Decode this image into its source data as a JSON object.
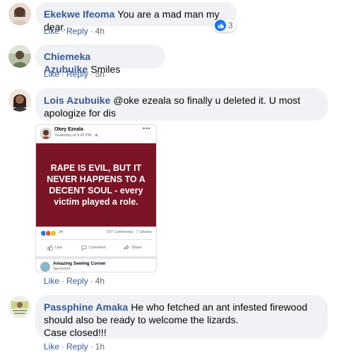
{
  "comments": [
    {
      "author": "Ekekwe Ifeoma",
      "text": "You are a mad man my dear.",
      "like": "Like",
      "reply": "Reply",
      "time": "4h",
      "reaction_count": "3"
    },
    {
      "author": "Chiemeka Azubuike",
      "text": "Smiles",
      "like": "Like",
      "reply": "Reply",
      "time": "5h"
    },
    {
      "author": "Lois Azubuike",
      "text": "@oke ezeala so finally u deleted it. U most apologize for dis",
      "like": "Like",
      "reply": "Reply",
      "time": "4h",
      "attachment": {
        "poster_name": "Okey Ezeala",
        "poster_time": "Yesterday at 9:42 PM · ",
        "dots": "•••",
        "banner_text": "RAPE IS EVIL, BUT IT NEVER HAPPENS TO A DECENT SOUL - every victim played a role.",
        "reaction_count": "34",
        "comments_shares": "157 Comments · 7 Shares",
        "btn_like": "Like",
        "btn_comment": "Comment",
        "btn_share": "Share",
        "next_name": "Amazing Sewing Corner",
        "next_sub": "Sponsored · "
      }
    },
    {
      "author": "Passphine Amaka",
      "text": "He who fetched an ant infested firewood should also be ready to welcome the lizards.",
      "text2": "Case closed!!!",
      "like": "Like",
      "reply": "Reply",
      "time": "1h"
    }
  ],
  "colors": {
    "author": "#385898",
    "bubble": "#f0f2f5",
    "banner": "#7b1425",
    "like_blue": "#1877f2"
  }
}
